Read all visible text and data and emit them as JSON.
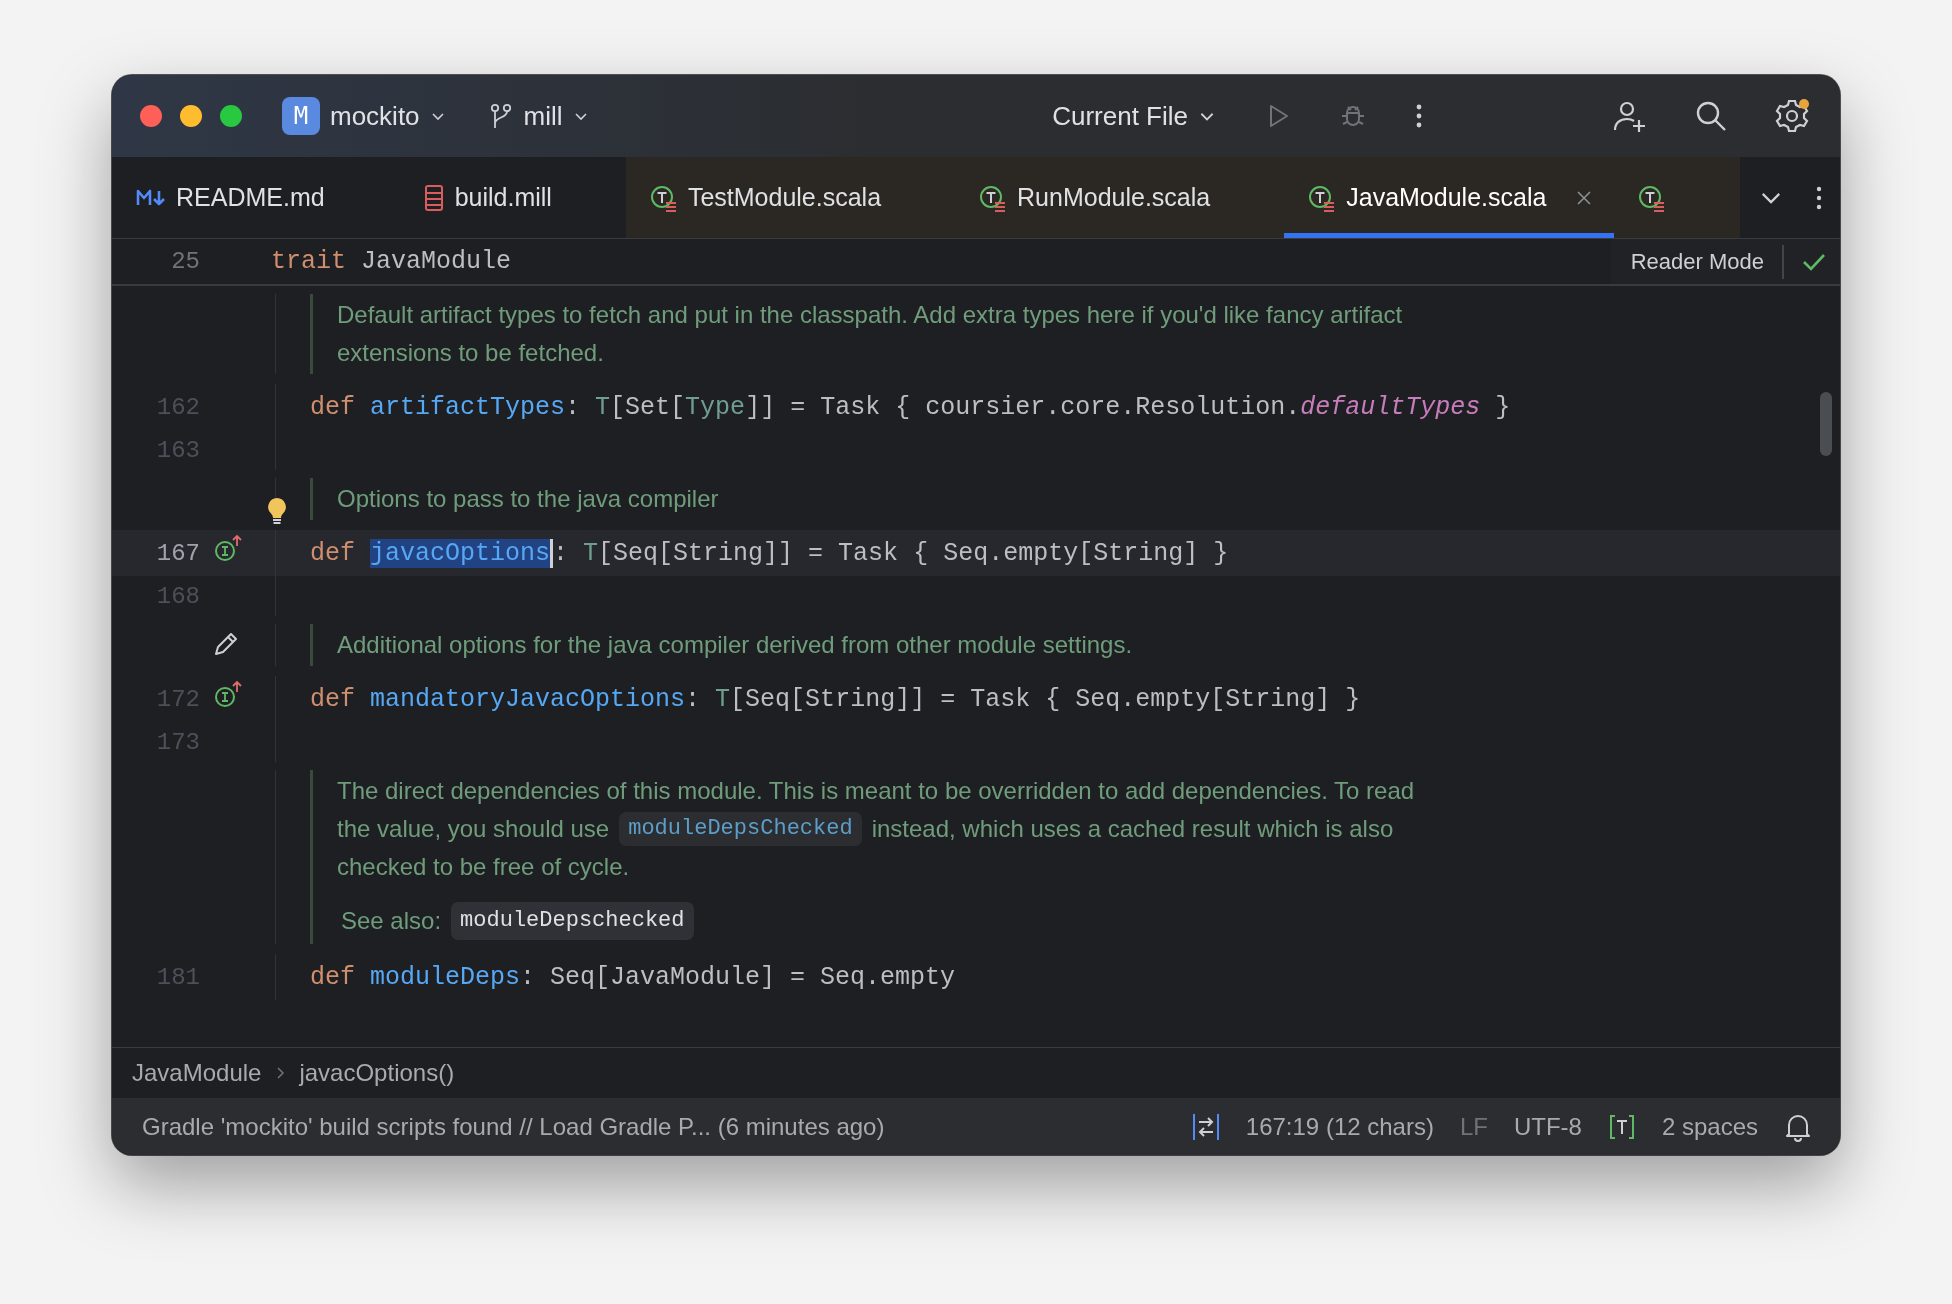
{
  "title_bar": {
    "project": {
      "badge": "M",
      "name": "mockito"
    },
    "branch": "mill",
    "run_config": "Current File"
  },
  "tabs": [
    {
      "kind": "markdown",
      "label": "README.md",
      "selected": false
    },
    {
      "kind": "mill",
      "label": "build.mill",
      "selected": false
    },
    {
      "kind": "scala",
      "label": "TestModule.scala",
      "selected": false
    },
    {
      "kind": "scala",
      "label": "RunModule.scala",
      "selected": false
    },
    {
      "kind": "scala",
      "label": "JavaModule.scala",
      "selected": true
    },
    {
      "kind": "scala",
      "selected": false
    }
  ],
  "sticky_header": {
    "line_number": "25",
    "keyword": "trait",
    "name": "JavaModule",
    "reader_mode": "Reader Mode"
  },
  "editor": {
    "rows": [
      {
        "kind": "doc",
        "lines": [
          [
            {
              "kind": "text",
              "text": "Default artifact types to fetch and put in the classpath. Add extra types here if you'd like fancy artifact"
            }
          ],
          [
            {
              "kind": "text",
              "text": "extensions to be fetched."
            }
          ]
        ]
      },
      {
        "kind": "code",
        "number": "162",
        "current": false,
        "tokens": [
          {
            "kind": "kw",
            "text": "def "
          },
          {
            "kind": "name",
            "text": "artifactTypes"
          },
          {
            "kind": "plain",
            "text": ": "
          },
          {
            "kind": "type",
            "text": "T"
          },
          {
            "kind": "plain",
            "text": "[Set["
          },
          {
            "kind": "type",
            "text": "Type"
          },
          {
            "kind": "plain",
            "text": "]] = Task { coursier.core.Resolution."
          },
          {
            "kind": "field",
            "text": "defaultTypes"
          },
          {
            "kind": "plain",
            "text": " }"
          }
        ]
      },
      {
        "kind": "blank",
        "number": "163"
      },
      {
        "kind": "doc",
        "gutter_icon": {
          "kind": "bulb"
        },
        "lines": [
          [
            {
              "kind": "text",
              "text": "Options to pass to the java compiler"
            }
          ]
        ]
      },
      {
        "kind": "code",
        "number": "167",
        "current": true,
        "gutter_icon": {
          "kind": "override"
        },
        "tokens": [
          {
            "kind": "kw",
            "text": "def "
          },
          {
            "kind": "selection",
            "text": "javacOptions"
          },
          {
            "kind": "plain",
            "text": ": "
          },
          {
            "kind": "type",
            "text": "T"
          },
          {
            "kind": "plain",
            "text": "[Seq[String]] = Task { Seq.empty[String] }"
          }
        ]
      },
      {
        "kind": "blank",
        "number": "168"
      },
      {
        "kind": "doc",
        "gutter_icon": {
          "kind": "edit"
        },
        "lines": [
          [
            {
              "kind": "text",
              "text": "Additional options for the java compiler derived from other module settings."
            }
          ]
        ]
      },
      {
        "kind": "code",
        "number": "172",
        "current": false,
        "gutter_icon": {
          "kind": "override"
        },
        "tokens": [
          {
            "kind": "kw",
            "text": "def "
          },
          {
            "kind": "name",
            "text": "mandatoryJavacOptions"
          },
          {
            "kind": "plain",
            "text": ": "
          },
          {
            "kind": "type",
            "text": "T"
          },
          {
            "kind": "plain",
            "text": "[Seq[String]] = Task { Seq.empty[String] }"
          }
        ]
      },
      {
        "kind": "blank",
        "number": "173"
      },
      {
        "kind": "doc",
        "lines": [
          [
            {
              "kind": "text",
              "text": "The direct dependencies of this module. This is meant to be overridden to add dependencies. To read"
            }
          ],
          [
            {
              "kind": "text",
              "text": "the value, you should use"
            },
            {
              "kind": "link",
              "text": "moduleDepsChecked"
            },
            {
              "kind": "text",
              "text": "instead, which uses a cached result which is also"
            }
          ],
          [
            {
              "kind": "text",
              "text": "checked to be free of cycle."
            }
          ],
          [
            {
              "kind": "see",
              "text": "See also:"
            },
            {
              "kind": "chip",
              "text": "moduleDepschecked"
            }
          ]
        ]
      },
      {
        "kind": "code",
        "number": "181",
        "current": false,
        "tokens": [
          {
            "kind": "kw",
            "text": "def "
          },
          {
            "kind": "name",
            "text": "moduleDeps"
          },
          {
            "kind": "plain",
            "text": ": Seq[JavaModule] = Seq.empty"
          }
        ]
      }
    ]
  },
  "breadcrumb": [
    "JavaModule",
    "javacOptions()"
  ],
  "status_bar": {
    "message": "Gradle 'mockito' build scripts found // Load Gradle P... (6 minutes ago)",
    "position": "167:19 (12 chars)",
    "line_ending": "LF",
    "encoding": "UTF-8",
    "indent": "2 spaces"
  }
}
